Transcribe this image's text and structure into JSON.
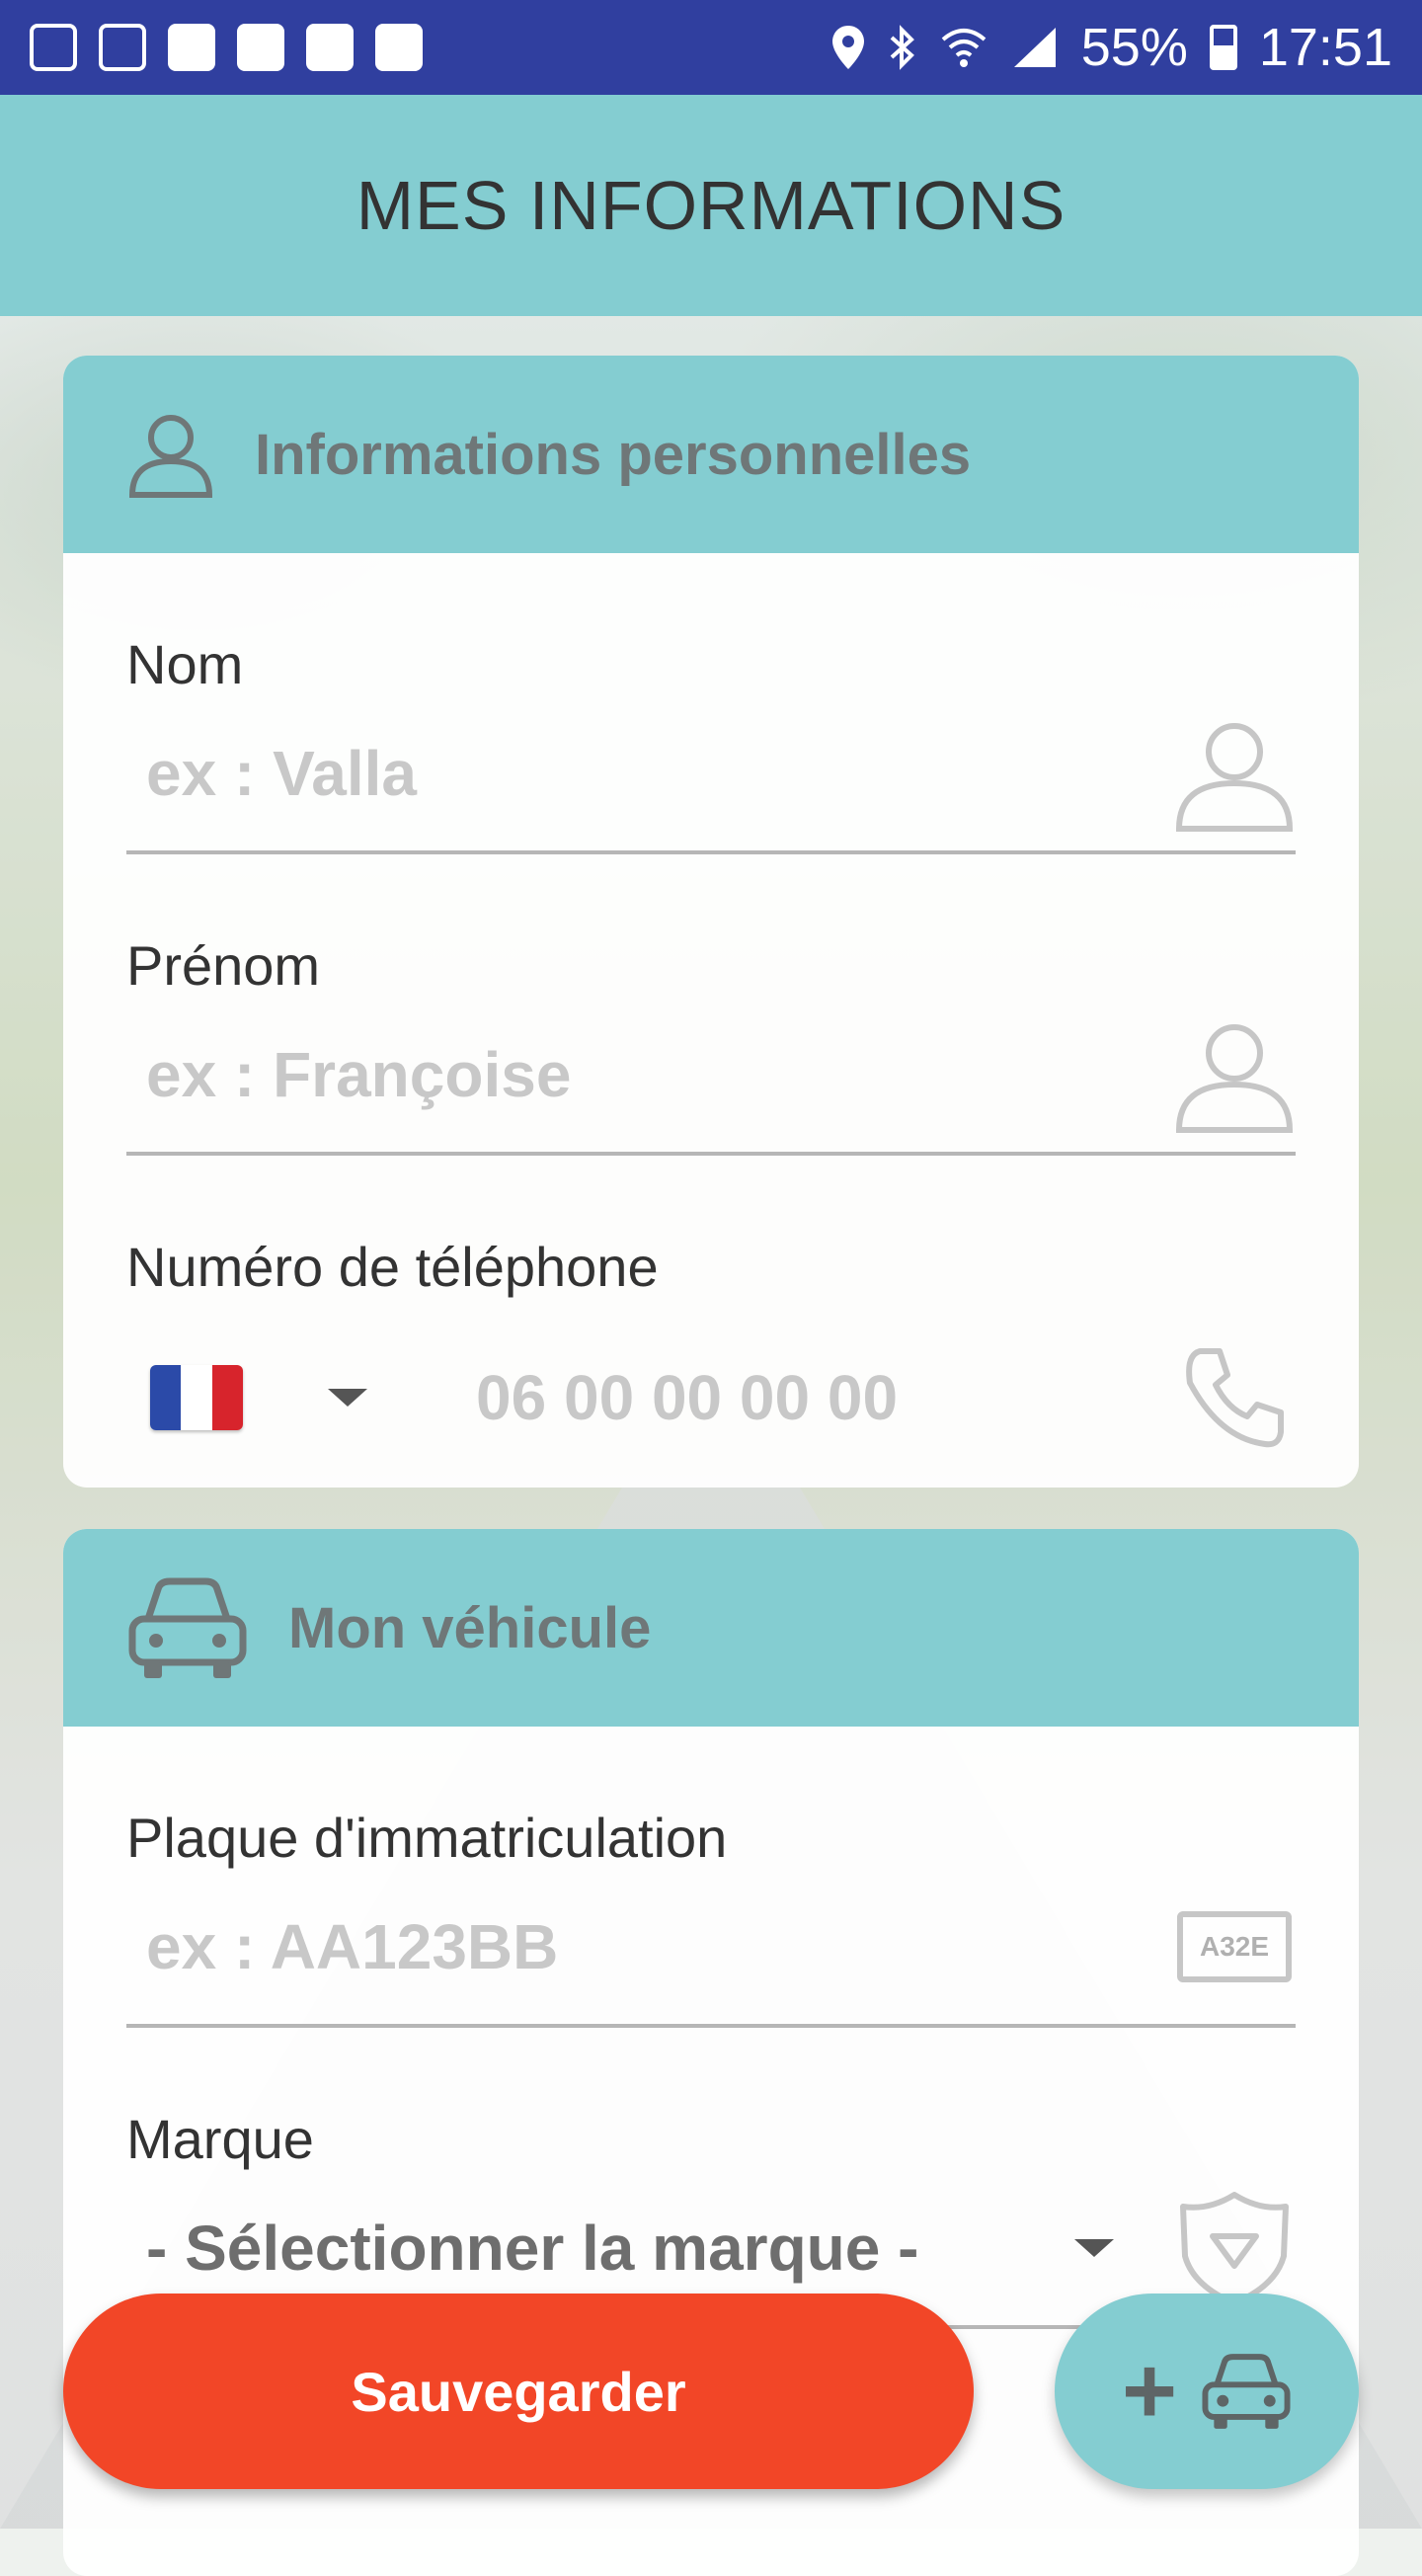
{
  "status_bar": {
    "notification_icons": [
      "doc-icon",
      "image-icon",
      "galaxy-icon",
      "galaxy-icon",
      "galaxy-icon",
      "game-icon"
    ],
    "battery": "55%",
    "time": "17:51"
  },
  "app_bar": {
    "title": "MES INFORMATIONS"
  },
  "personal": {
    "header": "Informations personnelles",
    "nom": {
      "label": "Nom",
      "placeholder": "ex : Valla"
    },
    "prenom": {
      "label": "Prénom",
      "placeholder": "ex : Françoise"
    },
    "phone": {
      "label": "Numéro de téléphone",
      "country": "FR",
      "placeholder": "06 00 00 00 00"
    }
  },
  "vehicle": {
    "header": "Mon véhicule",
    "plate": {
      "label": "Plaque d'immatriculation",
      "placeholder": "ex : AA123BB",
      "icon_text": "A32E"
    },
    "brand": {
      "label": "Marque",
      "selected": "- Sélectionner la marque -"
    }
  },
  "actions": {
    "save": "Sauvegarder",
    "add_vehicle_plus": "+"
  },
  "colors": {
    "accent": "#84cdd1",
    "save": "#f24627",
    "status_bar": "#303f9f"
  }
}
